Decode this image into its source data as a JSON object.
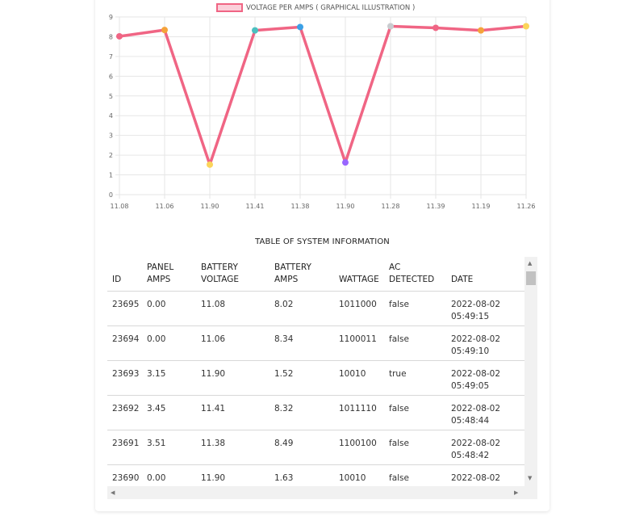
{
  "chart_data": {
    "type": "line",
    "legend": "VOLTAGE PER AMPS ( GRAPHICAL ILLUSTRATION )",
    "categories": [
      "11.08",
      "11.06",
      "11.90",
      "11.41",
      "11.38",
      "11.90",
      "11.28",
      "11.39",
      "11.19",
      "11.26"
    ],
    "values": [
      8.02,
      8.34,
      1.52,
      8.32,
      8.49,
      1.63,
      8.53,
      8.45,
      8.32,
      8.53
    ],
    "ylim": [
      0,
      9
    ],
    "yticks": [
      "0",
      "1",
      "2",
      "3",
      "4",
      "5",
      "6",
      "7",
      "8",
      "9"
    ],
    "grid": true,
    "line_color": "#f06584",
    "point_colors": [
      "#f06584",
      "#f5a33a",
      "#fbd45a",
      "#4bc0c0",
      "#3ba0e6",
      "#9966ff",
      "#c9cbcf",
      "#f06584",
      "#f5a33a",
      "#fbd45a"
    ]
  },
  "table": {
    "title": "TABLE OF SYSTEM INFORMATION",
    "headers": [
      {
        "l1": "",
        "l2": "ID"
      },
      {
        "l1": "PANEL",
        "l2": "AMPS"
      },
      {
        "l1": "BATTERY",
        "l2": "VOLTAGE"
      },
      {
        "l1": "BATTERY",
        "l2": "AMPS"
      },
      {
        "l1": "",
        "l2": "WATTAGE"
      },
      {
        "l1": "AC",
        "l2": "DETECTED"
      },
      {
        "l1": "",
        "l2": "DATE"
      }
    ],
    "rows": [
      {
        "id": "23695",
        "panel_amps": "0.00",
        "battery_voltage": "11.08",
        "battery_amps": "8.02",
        "wattage": "1011000",
        "ac": "false",
        "date": "2022-08-02",
        "time": "05:49:15"
      },
      {
        "id": "23694",
        "panel_amps": "0.00",
        "battery_voltage": "11.06",
        "battery_amps": "8.34",
        "wattage": "1100011",
        "ac": "false",
        "date": "2022-08-02",
        "time": "05:49:10"
      },
      {
        "id": "23693",
        "panel_amps": "3.15",
        "battery_voltage": "11.90",
        "battery_amps": "1.52",
        "wattage": "10010",
        "ac": "true",
        "date": "2022-08-02",
        "time": "05:49:05"
      },
      {
        "id": "23692",
        "panel_amps": "3.45",
        "battery_voltage": "11.41",
        "battery_amps": "8.32",
        "wattage": "1011110",
        "ac": "false",
        "date": "2022-08-02",
        "time": "05:48:44"
      },
      {
        "id": "23691",
        "panel_amps": "3.51",
        "battery_voltage": "11.38",
        "battery_amps": "8.49",
        "wattage": "1100100",
        "ac": "false",
        "date": "2022-08-02",
        "time": "05:48:42"
      },
      {
        "id": "23690",
        "panel_amps": "0.00",
        "battery_voltage": "11.90",
        "battery_amps": "1.63",
        "wattage": "10010",
        "ac": "false",
        "date": "2022-08-02",
        "time": ""
      }
    ]
  }
}
